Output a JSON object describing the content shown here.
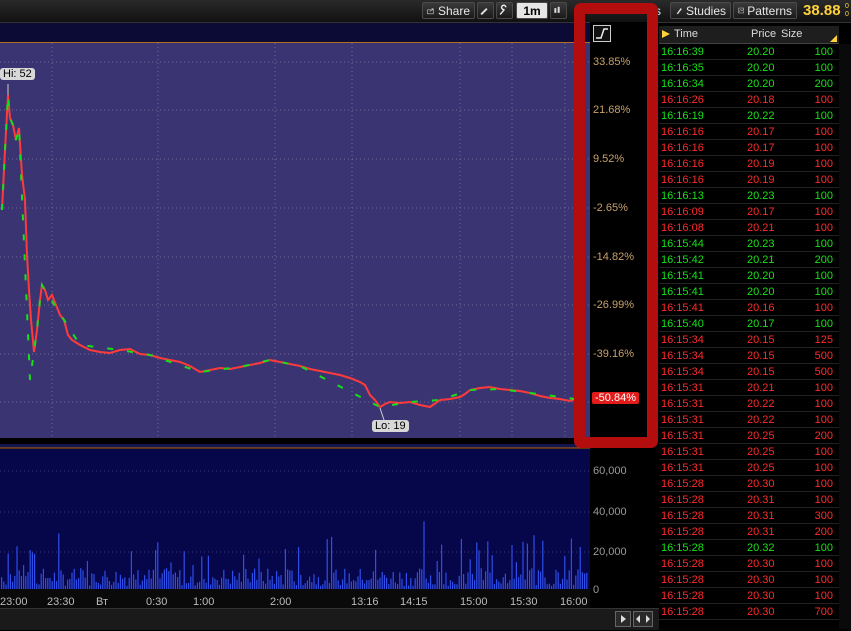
{
  "toolbar": {
    "share_label": "Share",
    "interval_label": "1m",
    "partial_label": "s",
    "studies_label": "Studies",
    "patterns_label": "Patterns",
    "price": "38.88",
    "price_frac_top": "0",
    "price_frac_bottom": "0"
  },
  "chart": {
    "hi_label": "Hi: 52",
    "lo_label": "Lo: 19",
    "current_pct": "-50.84%",
    "pct_ticks": [
      "33.85%",
      "21.68%",
      "9.52%",
      "-2.65%",
      "-14.82%",
      "-26.99%",
      "-39.16%"
    ],
    "volume_ticks": [
      "60,000",
      "40,000",
      "20,000",
      "0"
    ],
    "x_labels": [
      "23:00",
      "23:30",
      "Вт",
      "0:30",
      "1:00",
      "2:00",
      "13:16",
      "14:15",
      "15:00",
      "15:30",
      "16:00"
    ],
    "colors": {
      "up": "#18e018",
      "down": "#ff2a2a",
      "plot_bg": "#3a3572",
      "volume_bg": "#06064a",
      "highlight": "#b30d0d"
    }
  },
  "time_sales": {
    "header": {
      "time": "Time",
      "price": "Price",
      "size": "Size"
    },
    "rows": [
      {
        "time": "16:16:39",
        "price": "20.20",
        "size": "100",
        "dir": "up"
      },
      {
        "time": "16:16:35",
        "price": "20.20",
        "size": "100",
        "dir": "up"
      },
      {
        "time": "16:16:34",
        "price": "20.20",
        "size": "200",
        "dir": "up"
      },
      {
        "time": "16:16:26",
        "price": "20.18",
        "size": "100",
        "dir": "dn"
      },
      {
        "time": "16:16:19",
        "price": "20.22",
        "size": "100",
        "dir": "up"
      },
      {
        "time": "16:16:16",
        "price": "20.17",
        "size": "100",
        "dir": "dn"
      },
      {
        "time": "16:16:16",
        "price": "20.17",
        "size": "100",
        "dir": "dn"
      },
      {
        "time": "16:16:16",
        "price": "20.19",
        "size": "100",
        "dir": "dn"
      },
      {
        "time": "16:16:16",
        "price": "20.19",
        "size": "100",
        "dir": "dn"
      },
      {
        "time": "16:16:13",
        "price": "20.23",
        "size": "100",
        "dir": "up"
      },
      {
        "time": "16:16:09",
        "price": "20.17",
        "size": "100",
        "dir": "dn"
      },
      {
        "time": "16:16:08",
        "price": "20.21",
        "size": "100",
        "dir": "dn"
      },
      {
        "time": "16:15:44",
        "price": "20.23",
        "size": "100",
        "dir": "up"
      },
      {
        "time": "16:15:42",
        "price": "20.21",
        "size": "200",
        "dir": "up"
      },
      {
        "time": "16:15:41",
        "price": "20.20",
        "size": "100",
        "dir": "up"
      },
      {
        "time": "16:15:41",
        "price": "20.20",
        "size": "100",
        "dir": "up"
      },
      {
        "time": "16:15:41",
        "price": "20.16",
        "size": "100",
        "dir": "dn"
      },
      {
        "time": "16:15:40",
        "price": "20.17",
        "size": "100",
        "dir": "up"
      },
      {
        "time": "16:15:34",
        "price": "20.15",
        "size": "125",
        "dir": "dn"
      },
      {
        "time": "16:15:34",
        "price": "20.15",
        "size": "500",
        "dir": "dn"
      },
      {
        "time": "16:15:34",
        "price": "20.15",
        "size": "500",
        "dir": "dn"
      },
      {
        "time": "16:15:31",
        "price": "20.21",
        "size": "100",
        "dir": "dn"
      },
      {
        "time": "16:15:31",
        "price": "20.22",
        "size": "100",
        "dir": "dn"
      },
      {
        "time": "16:15:31",
        "price": "20.22",
        "size": "100",
        "dir": "dn"
      },
      {
        "time": "16:15:31",
        "price": "20.25",
        "size": "200",
        "dir": "dn"
      },
      {
        "time": "16:15:31",
        "price": "20.25",
        "size": "100",
        "dir": "dn"
      },
      {
        "time": "16:15:31",
        "price": "20.25",
        "size": "100",
        "dir": "dn"
      },
      {
        "time": "16:15:28",
        "price": "20.30",
        "size": "100",
        "dir": "dn"
      },
      {
        "time": "16:15:28",
        "price": "20.31",
        "size": "100",
        "dir": "dn"
      },
      {
        "time": "16:15:28",
        "price": "20.31",
        "size": "300",
        "dir": "dn"
      },
      {
        "time": "16:15:28",
        "price": "20.31",
        "size": "200",
        "dir": "dn"
      },
      {
        "time": "16:15:28",
        "price": "20.32",
        "size": "100",
        "dir": "up"
      },
      {
        "time": "16:15:28",
        "price": "20.30",
        "size": "100",
        "dir": "dn"
      },
      {
        "time": "16:15:28",
        "price": "20.30",
        "size": "100",
        "dir": "dn"
      },
      {
        "time": "16:15:28",
        "price": "20.30",
        "size": "100",
        "dir": "dn"
      },
      {
        "time": "16:15:28",
        "price": "20.30",
        "size": "700",
        "dir": "dn"
      }
    ]
  }
}
